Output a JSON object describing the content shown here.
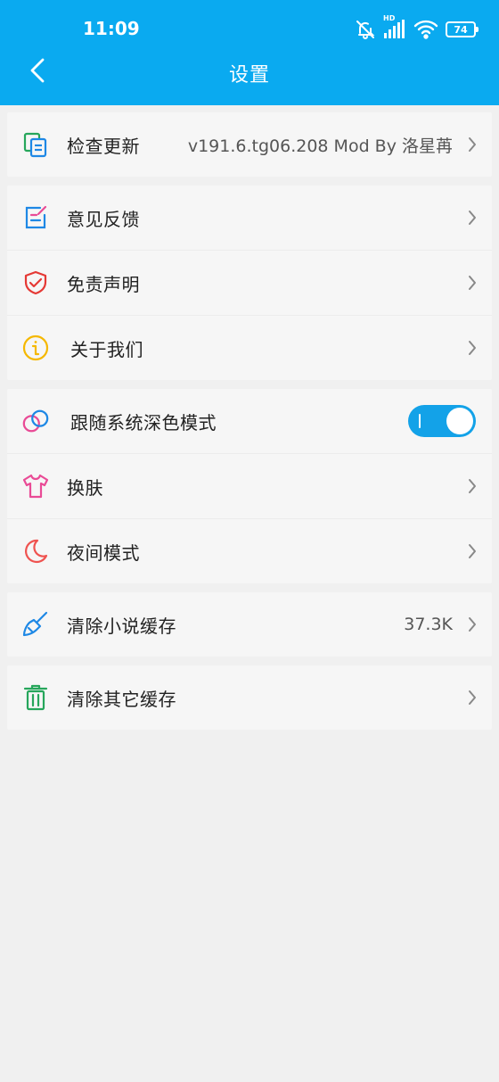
{
  "status_bar": {
    "time": "11:09",
    "battery": "74",
    "network_label": "HD"
  },
  "header": {
    "title": "设置",
    "back_icon": "chevron-left-icon"
  },
  "groups": [
    {
      "items": [
        {
          "label": "检查更新",
          "value": "v191.6.tg06.208 Mod By 洛星苒",
          "icon": "update-copy-icon",
          "color": "#1e88e5"
        }
      ]
    },
    {
      "items": [
        {
          "label": "意见反馈",
          "icon": "feedback-edit-icon",
          "color": "#1e88e5"
        },
        {
          "label": "免责声明",
          "icon": "shield-check-icon",
          "color": "#e53935"
        },
        {
          "label": "关于我们",
          "icon": "info-icon",
          "color": "#f5b800"
        }
      ]
    },
    {
      "items": [
        {
          "label": "跟随系统深色模式",
          "icon": "rings-icon",
          "toggle": true,
          "toggle_on": true
        },
        {
          "label": "换肤",
          "icon": "tshirt-icon",
          "color": "#e94b96"
        },
        {
          "label": "夜间模式",
          "icon": "moon-icon",
          "color": "#ef5350"
        }
      ]
    },
    {
      "items": [
        {
          "label": "清除小说缓存",
          "value": "37.3K",
          "icon": "broom-icon",
          "color": "#1e88e5"
        }
      ]
    },
    {
      "items": [
        {
          "label": "清除其它缓存",
          "icon": "trash-icon",
          "color": "#26a65b"
        }
      ]
    }
  ],
  "colors": {
    "accent": "#0aaaf0",
    "toggle": "#13a2e8",
    "background": "#f0f0f0"
  }
}
